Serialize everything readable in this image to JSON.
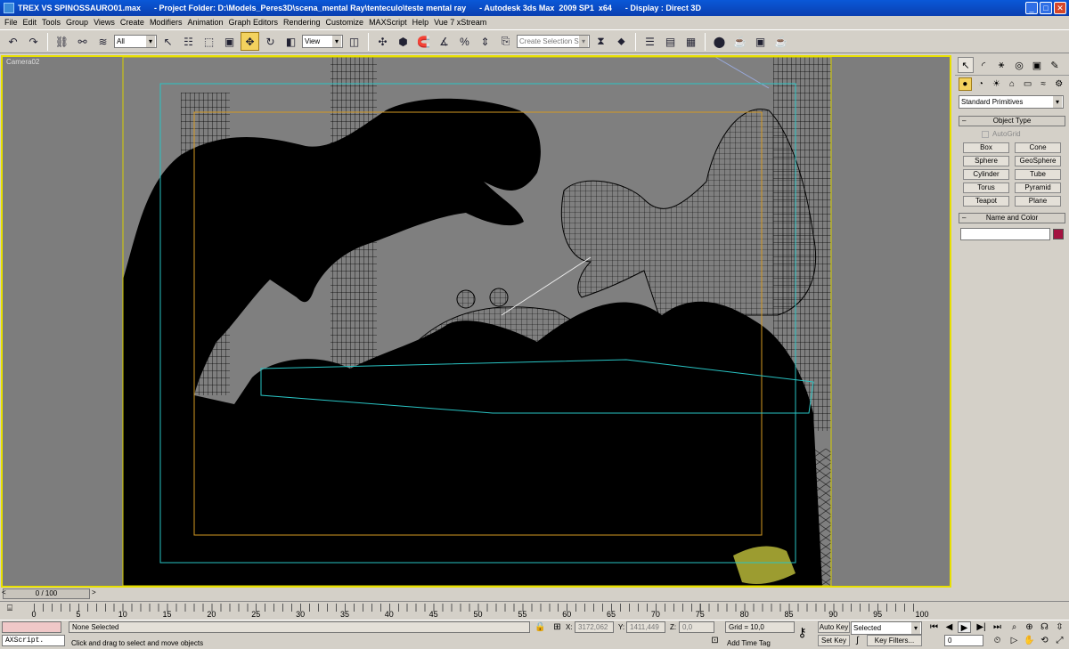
{
  "title": {
    "text": "TREX VS SPINOSSAURO01.max      - Project Folder: D:\\Models_Peres3D\\scena_mental Ray\\tenteculo\\teste mental ray      - Autodesk 3ds Max  2009 SP1  x64      - Display : Direct 3D",
    "minimize": "_",
    "maximize": "□",
    "close": "✕"
  },
  "menu": [
    "File",
    "Edit",
    "Tools",
    "Group",
    "Views",
    "Create",
    "Modifiers",
    "Animation",
    "Graph Editors",
    "Rendering",
    "Customize",
    "MAXScript",
    "Help",
    "Vue 7 xStream"
  ],
  "toolbar": {
    "filter": "All",
    "refcoord": "View",
    "selset_placeholder": "Create Selection Set"
  },
  "viewport": {
    "label": "Camera02"
  },
  "command_panel": {
    "category": "Standard Primitives",
    "object_type": "Object Type",
    "autogrid": "AutoGrid",
    "buttons": [
      "Box",
      "Cone",
      "Sphere",
      "GeoSphere",
      "Cylinder",
      "Tube",
      "Torus",
      "Pyramid",
      "Teapot",
      "Plane"
    ],
    "name_and_color": "Name and Color",
    "color": "#a41240"
  },
  "timeslider": {
    "frame": "0 / 100",
    "prev": "<",
    "next": ">",
    "progress": 0
  },
  "trackbar": {
    "ticks": [
      "0",
      "5",
      "10",
      "15",
      "20",
      "25",
      "30",
      "35",
      "40",
      "45",
      "50",
      "55",
      "60",
      "65",
      "70",
      "75",
      "80",
      "85",
      "90",
      "95",
      "100"
    ]
  },
  "status": {
    "maxscript": "AXScript.",
    "selection": "None Selected",
    "prompt": "Click and drag to select and move objects",
    "x_label": "X:",
    "x": "3172,062",
    "y_label": "Y:",
    "y": "1411,449",
    "z_label": "Z:",
    "z": "0,0",
    "grid": "Grid = 10,0",
    "add_time_tag": "Add Time Tag",
    "auto_key": "Auto Key",
    "set_key": "Set Key",
    "key_filter_value": "Selected",
    "key_filters": "Key Filters...",
    "frame": "0"
  }
}
